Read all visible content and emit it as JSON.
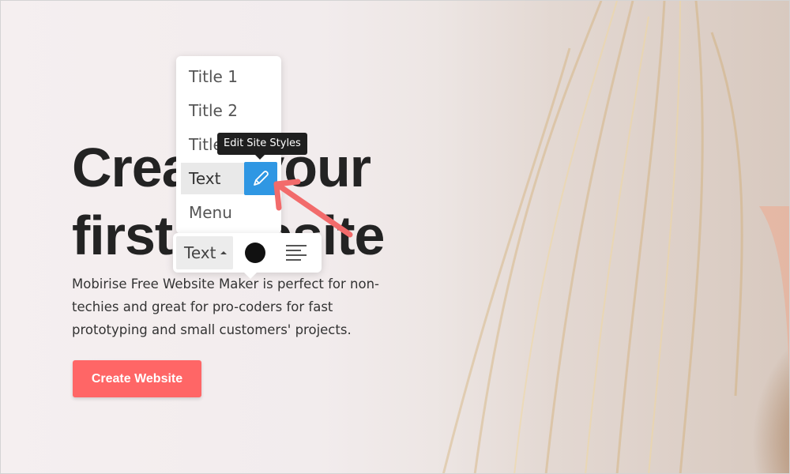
{
  "hero": {
    "headline": "Create your\nfirst website",
    "subtext": "Mobirise Free Website Maker is perfect for non-techies and great for pro-coders for fast prototyping and small customers' projects.",
    "cta_label": "Create Website"
  },
  "style_menu": {
    "items": [
      "Title 1",
      "Title 2",
      "Title 3",
      "Text",
      "Menu"
    ],
    "selected": "Text"
  },
  "tooltip": "Edit Site Styles",
  "toolbar": {
    "type_label": "Text",
    "color_value": "#111111"
  },
  "colors": {
    "accent": "#ff6666",
    "edit_button": "#2f97e3",
    "annotation_arrow": "#f26b6b"
  },
  "icons": {
    "edit": "pencil-icon",
    "align": "align-left-icon",
    "caret": "caret-up-icon",
    "color": "color-swatch-icon"
  }
}
